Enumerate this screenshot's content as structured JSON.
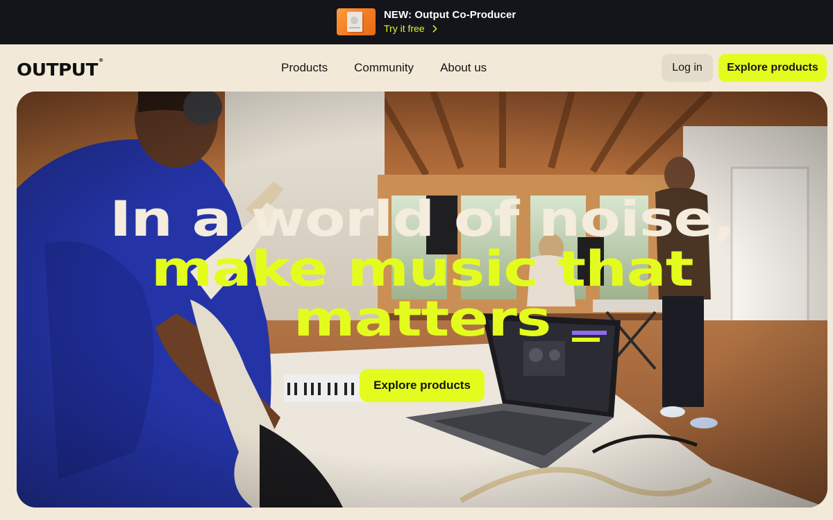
{
  "promo": {
    "title": "NEW: Output Co-Producer",
    "link_label": "Try it free",
    "thumbnail_colors": [
      "#ff9c3c",
      "#e86a1a"
    ]
  },
  "header": {
    "logo": "OUTPUT",
    "logo_mark": "®",
    "nav": [
      {
        "label": "Products"
      },
      {
        "label": "Community"
      },
      {
        "label": "About us"
      }
    ],
    "login_label": "Log in",
    "cta_label": "Explore products"
  },
  "hero": {
    "title_line1": "In a world of noise,",
    "title_line2": "make music that",
    "title_line3": "matters",
    "cta_label": "Explore products"
  },
  "colors": {
    "accent": "#e4fc1d",
    "background": "#f2e9d8",
    "dark": "#14151b"
  }
}
